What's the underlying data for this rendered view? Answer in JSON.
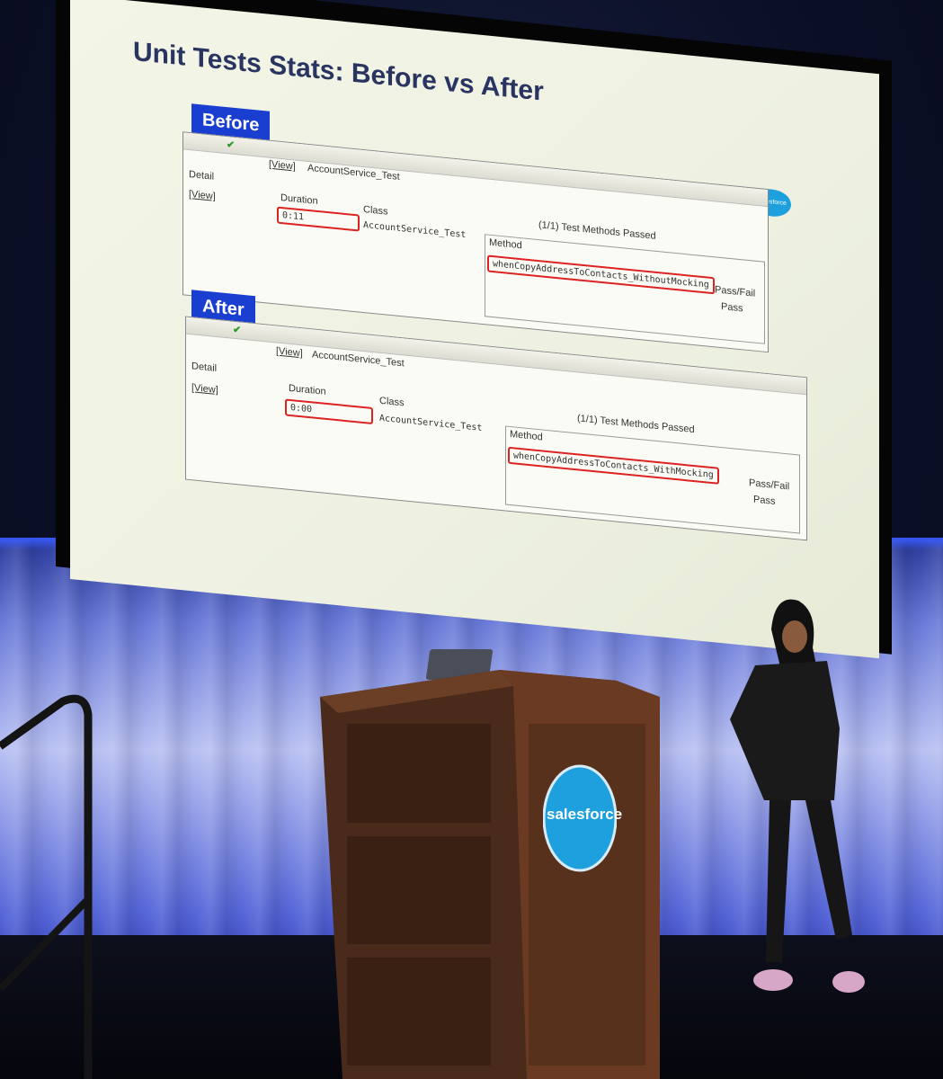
{
  "slide": {
    "title": "Unit Tests Stats: Before vs After",
    "logo_text": "salesforce",
    "before": {
      "tag": "Before",
      "view_link": "[View]",
      "suite_name": "AccountService_Test",
      "detail_header": "Detail",
      "detail_link": "[View]",
      "duration_header": "Duration",
      "duration_value": "0:11",
      "class_header": "Class",
      "class_value": "AccountService_Test",
      "summary": "(1/1) Test Methods Passed",
      "method_header": "Method",
      "method_value": "whenCopyAddressToContacts_WithoutMocking",
      "passfail_header": "Pass/Fail",
      "passfail_value": "Pass"
    },
    "after": {
      "tag": "After",
      "view_link": "[View]",
      "suite_name": "AccountService_Test",
      "detail_header": "Detail",
      "detail_link": "[View]",
      "duration_header": "Duration",
      "duration_value": "0:00",
      "class_header": "Class",
      "class_value": "AccountService_Test",
      "summary": "(1/1) Test Methods Passed",
      "method_header": "Method",
      "method_value": "whenCopyAddressToContacts_WithMocking",
      "passfail_header": "Pass/Fail",
      "passfail_value": "Pass"
    }
  },
  "podium": {
    "logo_text": "salesforce"
  },
  "colors": {
    "tag_blue": "#1a3fd0",
    "highlight_red": "#dd2222",
    "salesforce_blue": "#1ea0de",
    "title_navy": "#2a3460",
    "curtain_blue": "#5566d8"
  }
}
